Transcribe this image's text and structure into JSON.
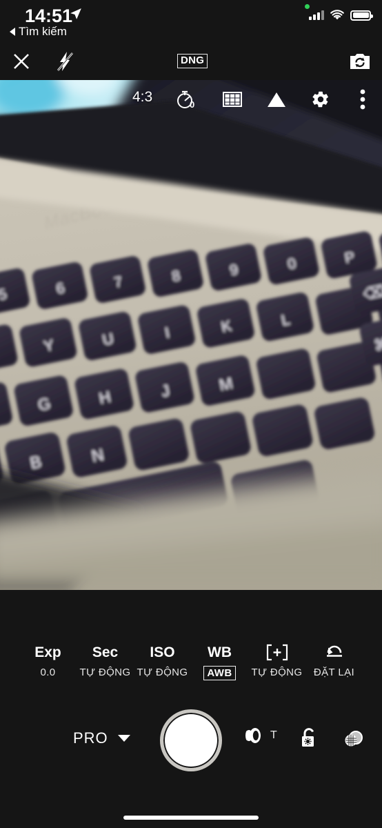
{
  "status_bar": {
    "time": "14:51",
    "location_icon": "location-arrow-icon",
    "back_label": "Tìm kiếm",
    "signal_icon": "cellular-signal-icon",
    "wifi_icon": "wifi-icon",
    "battery_icon": "battery-full-icon",
    "recording_indicator": "green-dot-indicator"
  },
  "top_bar": {
    "close_icon": "close-icon",
    "flash_icon": "flash-off-icon",
    "format_badge": "DNG",
    "flip_icon": "camera-flip-icon"
  },
  "overlay_bar": {
    "aspect_ratio": "4:3",
    "timer_icon": "timer-icon",
    "timer_value": "0",
    "grid_icon": "grid-icon",
    "level_icon": "level-triangle-icon",
    "settings_icon": "gear-icon",
    "more_icon": "more-vertical-icon"
  },
  "pro_controls": [
    {
      "name": "exposure",
      "label": "Exp",
      "value": "0.0",
      "boxed": false,
      "icon": ""
    },
    {
      "name": "shutter-speed",
      "label": "Sec",
      "value": "TỰ ĐỘNG",
      "boxed": false,
      "icon": ""
    },
    {
      "name": "iso",
      "label": "ISO",
      "value": "TỰ ĐỘNG",
      "boxed": false,
      "icon": ""
    },
    {
      "name": "white-balance",
      "label": "WB",
      "value": "AWB",
      "boxed": true,
      "icon": ""
    },
    {
      "name": "focus",
      "label": "",
      "value": "TỰ ĐỘNG",
      "boxed": false,
      "icon": "focus-bracket-plus-icon"
    },
    {
      "name": "reset",
      "label": "",
      "value": "ĐẶT LẠI",
      "boxed": false,
      "icon": "reset-undo-icon"
    }
  ],
  "shutter_row": {
    "mode_label": "PRO",
    "mode_chevron_icon": "chevron-down-icon",
    "shutter_icon": "shutter-button",
    "lens_icon": "lens-icon",
    "lens_label": "T",
    "lock_icon": "exposure-lock-icon",
    "filter_icon": "filter-circles-icon"
  },
  "preview": {
    "subject": "MacBook Pro keyboard close-up",
    "home_indicator": "home-indicator"
  },
  "colors": {
    "background": "#151515",
    "accent_white": "#ffffff",
    "status_green": "#30d158",
    "shutter_ring": "#c9c7c2"
  }
}
